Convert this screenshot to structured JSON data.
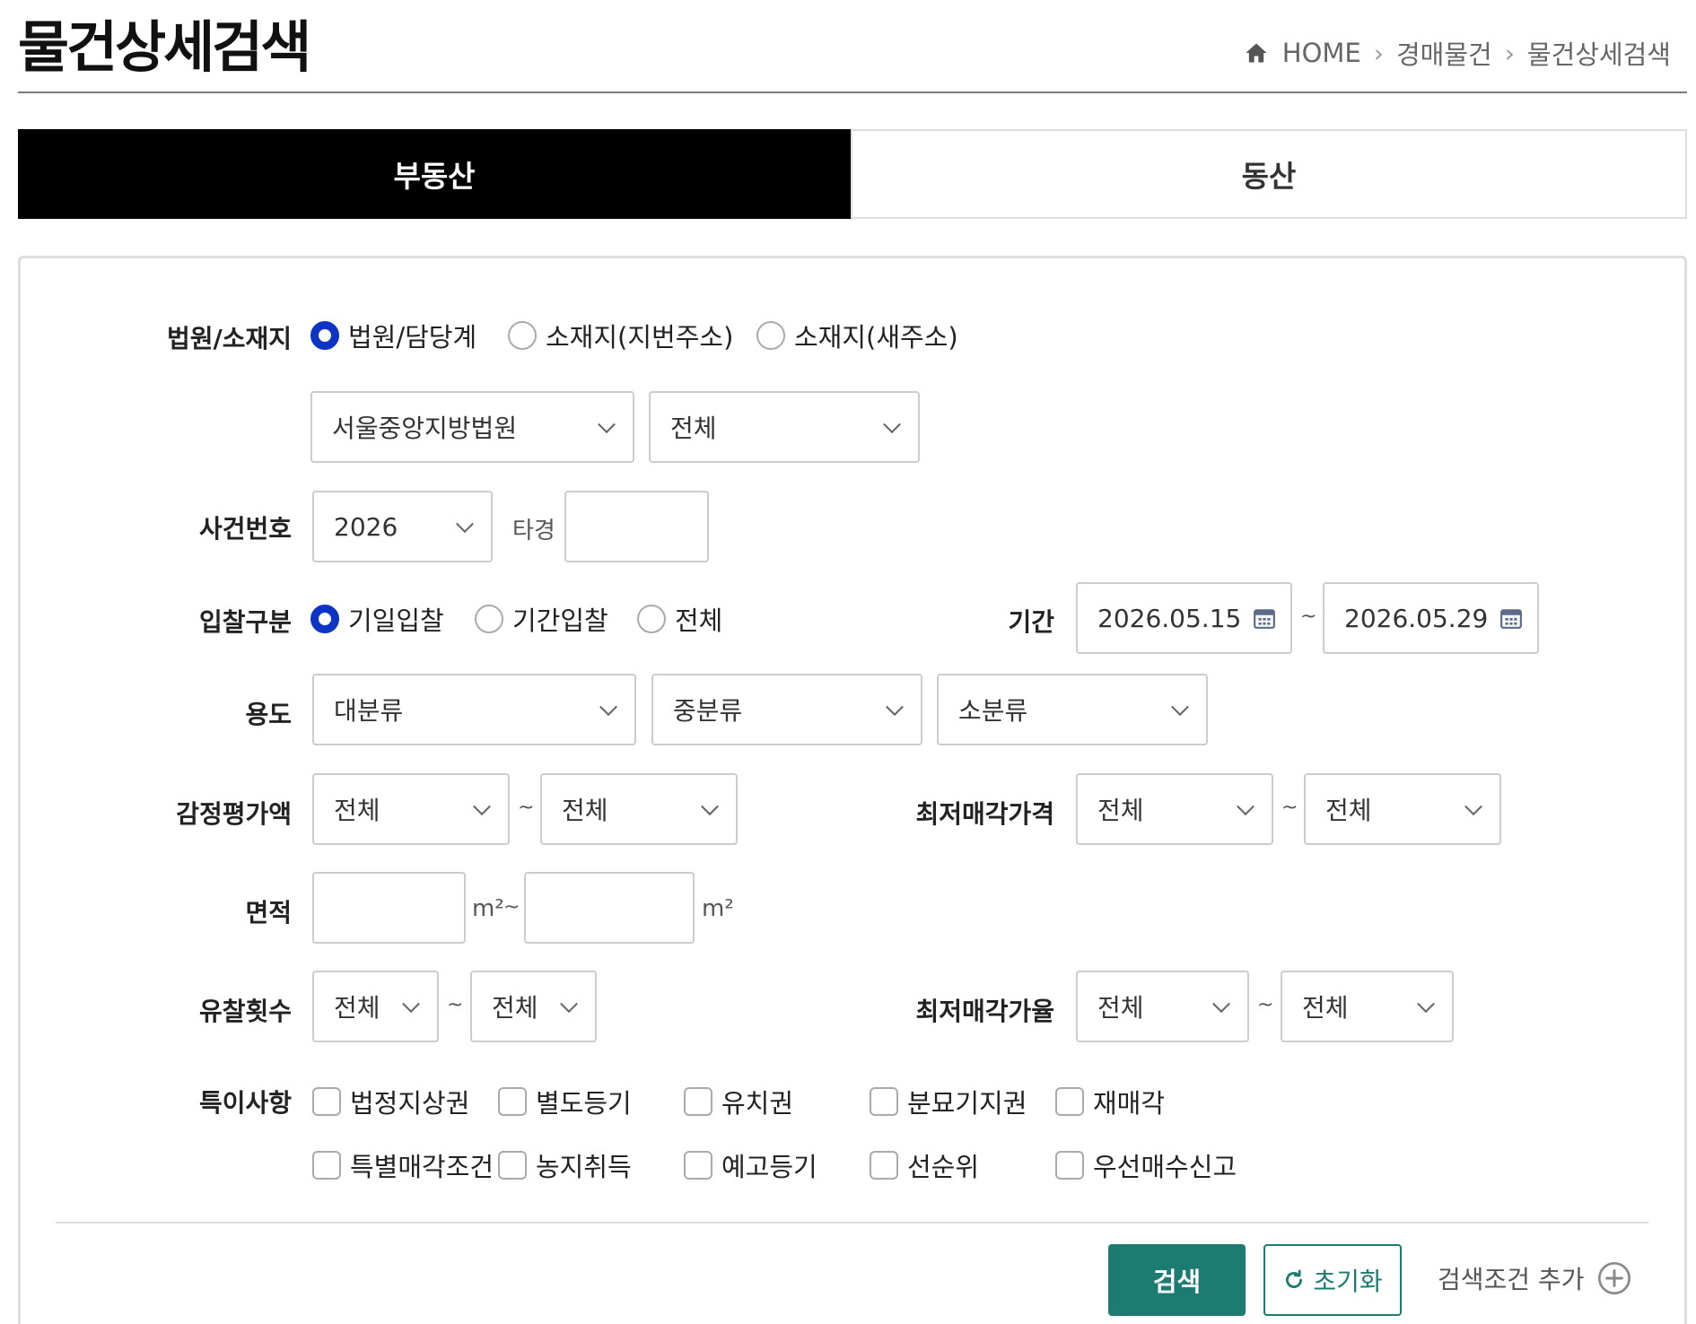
{
  "header": {
    "title": "물건상세검색",
    "breadcrumb": [
      "HOME",
      "경매물건",
      "물건상세검색"
    ]
  },
  "tabs": [
    {
      "label": "부동산",
      "active": true
    },
    {
      "label": "동산",
      "active": false
    }
  ],
  "form": {
    "court_location": {
      "label": "법원/소재지",
      "options": [
        "법원/담당계",
        "소재지(지번주소)",
        "소재지(새주소)"
      ],
      "selected": "법원/담당계",
      "court_select": "서울중앙지방법원",
      "division_select": "전체"
    },
    "case_number": {
      "label": "사건번호",
      "year": "2026",
      "prefix": "타경",
      "number": ""
    },
    "bid_type": {
      "label": "입찰구분",
      "options": [
        "기일입찰",
        "기간입찰",
        "전체"
      ],
      "selected": "기일입찰"
    },
    "period": {
      "label": "기간",
      "start": "2026.05.15",
      "end": "2026.05.29"
    },
    "usage": {
      "label": "용도",
      "major": "대분류",
      "middle": "중분류",
      "minor": "소분류"
    },
    "appraisal": {
      "label": "감정평가액",
      "min": "전체",
      "max": "전체"
    },
    "min_price": {
      "label": "최저매각가격",
      "min": "전체",
      "max": "전체"
    },
    "area": {
      "label": "면적",
      "min": "",
      "max": "",
      "unit": "m²"
    },
    "fail_count": {
      "label": "유찰횟수",
      "min": "전체",
      "max": "전체"
    },
    "min_rate": {
      "label": "최저매각가율",
      "min": "전체",
      "max": "전체"
    },
    "special": {
      "label": "특이사항",
      "items": [
        "법정지상권",
        "별도등기",
        "유치권",
        "분묘기지권",
        "재매각",
        "특별매각조건",
        "농지취득",
        "예고등기",
        "선순위",
        "우선매수신고"
      ]
    },
    "range_separator": "~"
  },
  "actions": {
    "search": "검색",
    "reset": "초기화",
    "add_condition": "검색조건 추가"
  },
  "colors": {
    "accent": "#1d7c72",
    "radio_selected": "#0d34c4",
    "active_tab": "#000000"
  }
}
